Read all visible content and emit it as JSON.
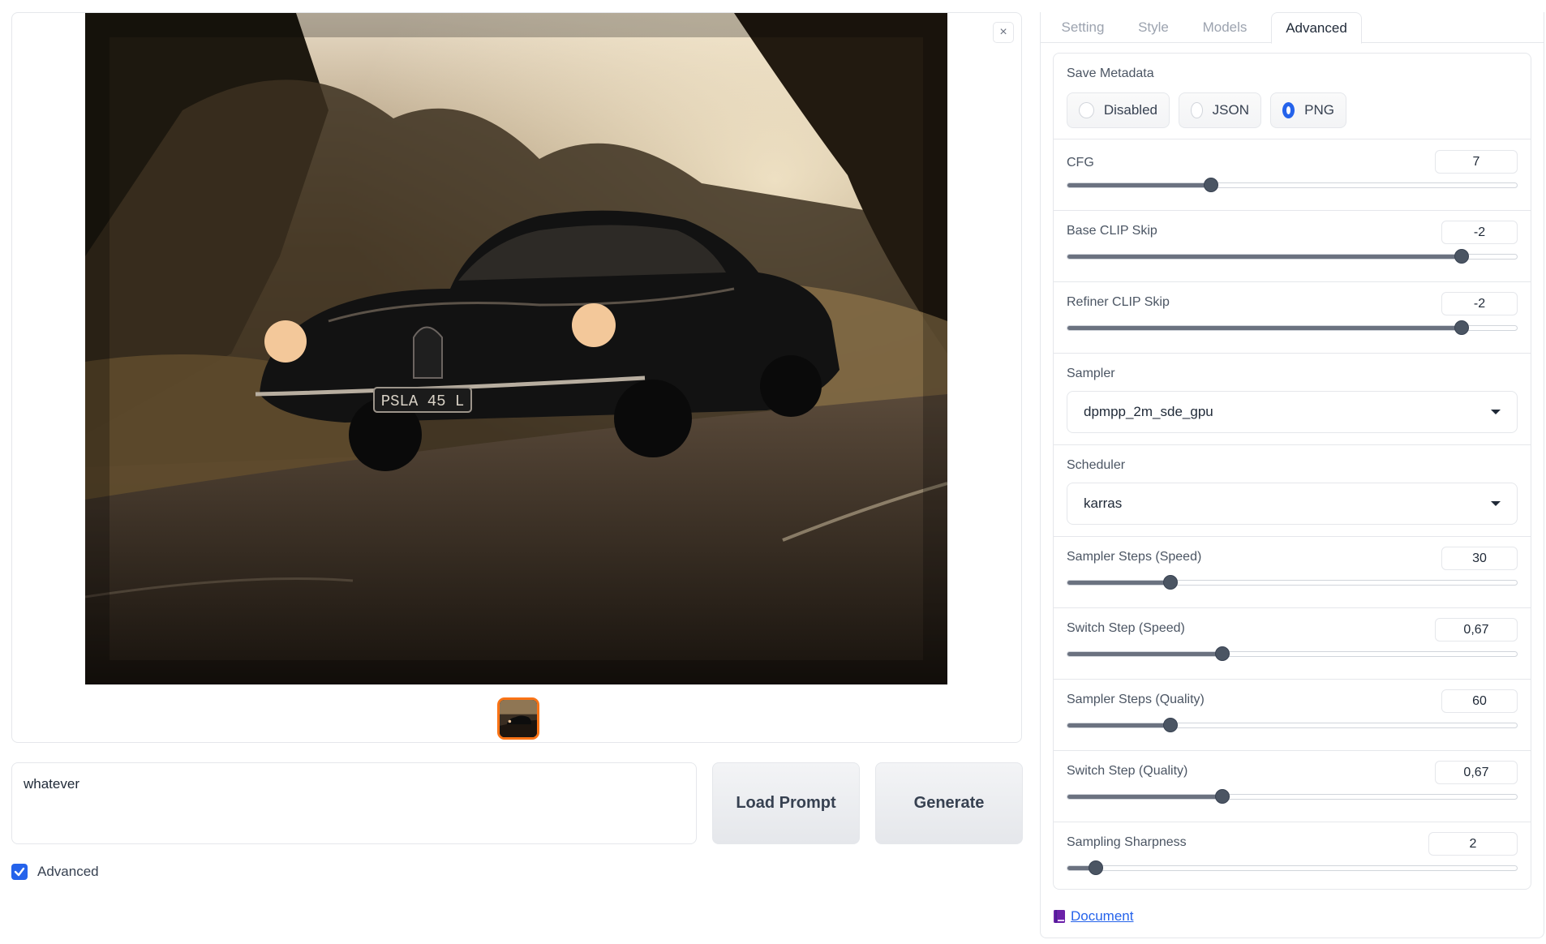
{
  "gallery": {
    "close_label": "×",
    "image": {
      "license_plate": "PSLA 45 L"
    }
  },
  "prompt": {
    "value": "whatever"
  },
  "buttons": {
    "load_prompt": "Load Prompt",
    "generate": "Generate"
  },
  "advanced_checkbox": {
    "label": "Advanced",
    "checked": true
  },
  "tabs": [
    "Setting",
    "Style",
    "Models",
    "Advanced"
  ],
  "active_tab": "Advanced",
  "settings": {
    "save_metadata": {
      "label": "Save Metadata",
      "options": [
        "Disabled",
        "JSON",
        "PNG"
      ],
      "selected": "PNG"
    },
    "cfg": {
      "label": "CFG",
      "value": "7",
      "fraction": 0.32
    },
    "base_clip_skip": {
      "label": "Base CLIP Skip",
      "value": "-2",
      "fraction": 0.875
    },
    "refiner_clip_skip": {
      "label": "Refiner CLIP Skip",
      "value": "-2",
      "fraction": 0.875
    },
    "sampler": {
      "label": "Sampler",
      "value": "dpmpp_2m_sde_gpu"
    },
    "scheduler": {
      "label": "Scheduler",
      "value": "karras"
    },
    "sampler_steps_speed": {
      "label": "Sampler Steps (Speed)",
      "value": "30",
      "fraction": 0.23
    },
    "switch_step_speed": {
      "label": "Switch Step (Speed)",
      "value": "0,67",
      "fraction": 0.345
    },
    "sampler_steps_quality": {
      "label": "Sampler Steps (Quality)",
      "value": "60",
      "fraction": 0.23
    },
    "switch_step_quality": {
      "label": "Switch Step (Quality)",
      "value": "0,67",
      "fraction": 0.345
    },
    "sampling_sharpness": {
      "label": "Sampling Sharpness",
      "value": "2",
      "fraction": 0.065
    }
  },
  "document_link": {
    "icon": "book-icon",
    "label": "Document"
  },
  "colors": {
    "accent": "#2563eb",
    "thumb_border": "#f97316",
    "slider_fill": "#6b7280"
  }
}
